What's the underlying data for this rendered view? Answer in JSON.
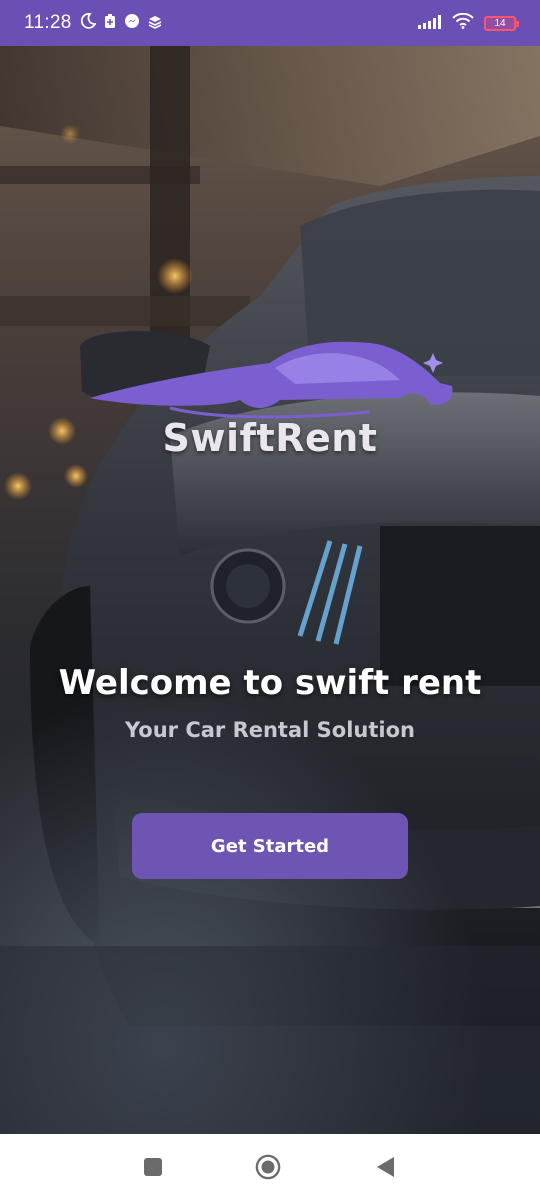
{
  "status_bar": {
    "time": "11:28",
    "battery_level": "14",
    "icons": [
      "moon-icon",
      "battery-saver-icon",
      "messenger-icon",
      "layers-icon",
      "signal-icon",
      "wifi-icon",
      "battery-icon"
    ]
  },
  "brand": {
    "name": "SwiftRent",
    "accent_color": "#6e55b3"
  },
  "welcome": {
    "title": "Welcome to swift rent",
    "subtitle": "Your Car Rental Solution"
  },
  "cta": {
    "label": "Get Started"
  },
  "nav_bar": {
    "icons": [
      "recent-apps-icon",
      "home-icon",
      "back-icon"
    ]
  }
}
